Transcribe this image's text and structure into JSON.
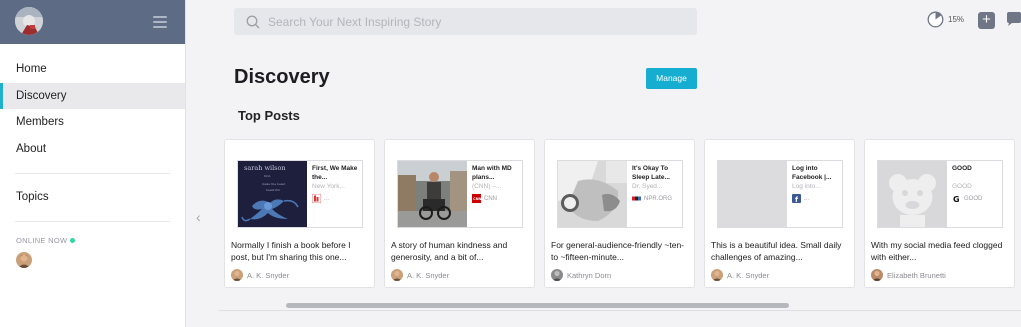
{
  "search": {
    "placeholder": "Search Your Next Inspiring Story"
  },
  "progress": {
    "value": 0.15,
    "label": "15%"
  },
  "sidebar": {
    "nav": [
      {
        "label": "Home"
      },
      {
        "label": "Discovery"
      },
      {
        "label": "Members"
      },
      {
        "label": "About"
      }
    ],
    "topics_label": "Topics",
    "online_label": "ONLINE NOW"
  },
  "main": {
    "title": "Discovery",
    "manage_label": "Manage",
    "section_title": "Top Posts"
  },
  "cards": [
    {
      "title": "First, We Make the...",
      "source": "New York...",
      "publisher": "...",
      "excerpt": "Normally I finish a book before I post, but I'm sharing this one...",
      "author": "A. K. Snyder"
    },
    {
      "title": "Man with MD plans...",
      "source": "(CNN) –...",
      "publisher": "CNN",
      "excerpt": "A story of human kindness and generosity, and a bit of...",
      "author": "A. K. Snyder"
    },
    {
      "title": "It's Okay To Sleep Late...",
      "source": "Dr. Syed...",
      "publisher": "NPR.ORG",
      "excerpt": "For general-audience-friendly ~ten- to ~fifteen-minute...",
      "author": "Kathryn Dorn"
    },
    {
      "title": "Log into Facebook |...",
      "source": "Log into...",
      "publisher": "...",
      "excerpt": "This is a beautiful idea. Small daily challenges of amazing...",
      "author": "A. K. Snyder"
    },
    {
      "title": "GOOD",
      "source": "GOOD",
      "publisher": "GOOD",
      "excerpt": "With my social media feed clogged with either...",
      "author": "Elizabeth Brunetti"
    }
  ],
  "colors": {
    "accent": "#16aed0",
    "sidebar_header": "#5e6b85",
    "online": "#2fd7a3"
  }
}
